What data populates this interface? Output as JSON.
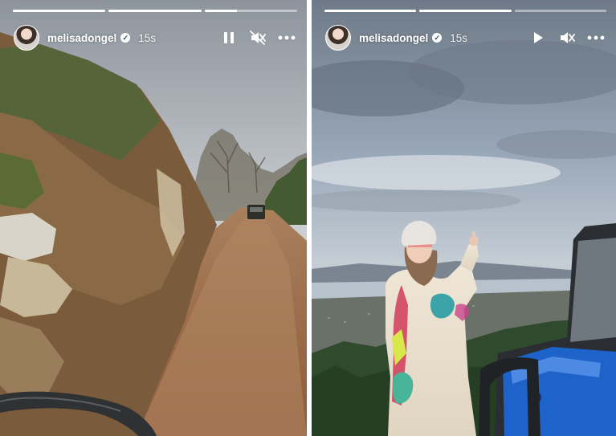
{
  "stories": [
    {
      "username": "melisadongel",
      "verified": true,
      "time_ago": "15s",
      "playback_state": "playing",
      "muted": true,
      "progress_segments": [
        1.0,
        1.0,
        0.35
      ],
      "icons": [
        "pause-icon",
        "muted-speaker-icon",
        "more-options-icon"
      ]
    },
    {
      "username": "melisadongel",
      "verified": true,
      "time_ago": "15s",
      "playback_state": "paused",
      "muted": true,
      "progress_segments": [
        1.0,
        1.0,
        0.0
      ],
      "icons": [
        "play-icon",
        "muted-speaker-icon",
        "more-options-icon"
      ]
    }
  ],
  "colors": {
    "overlay_text": "#ffffff",
    "progress_track": "rgba(255,255,255,0.45)",
    "progress_fill": "#ffffff"
  }
}
